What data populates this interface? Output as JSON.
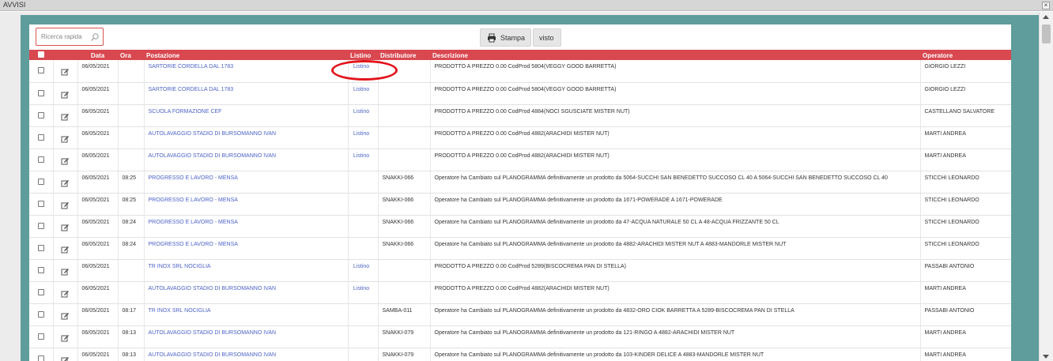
{
  "window": {
    "title": "AVVISI",
    "close_label": "×"
  },
  "toolbar": {
    "search_placeholder": "Ricerca rapida",
    "stampa_label": "Stampa",
    "visto_label": "visto"
  },
  "table": {
    "headers": {
      "data": "Data",
      "ora": "Ora",
      "postazione": "Postazione",
      "listino": "Listino",
      "distributore": "Distributore",
      "descrizione": "Descrizione",
      "operatore": "Operatore"
    },
    "rows": [
      {
        "data": "06/05/2021",
        "ora": "",
        "postazione": "SARTORIE CORDELLA DAL 1783",
        "listino": "Listino",
        "distributore": "",
        "descrizione": "PRODOTTO A PREZZO 0.00 CodProd 5804(VEGGY GOOD BARRETTA)",
        "operatore": "GIORGIO LEZZI"
      },
      {
        "data": "06/05/2021",
        "ora": "",
        "postazione": "SARTORIE CORDELLA DAL 1783",
        "listino": "Listino",
        "distributore": "",
        "descrizione": "PRODOTTO A PREZZO 0.00 CodProd 5804(VEGGY GOOD BARRETTA)",
        "operatore": "GIORGIO LEZZI"
      },
      {
        "data": "06/05/2021",
        "ora": "",
        "postazione": "SCUOLA FORMAZIONE CEF",
        "listino": "Listino",
        "distributore": "",
        "descrizione": "PRODOTTO A PREZZO 0.00 CodProd 4884(NOCI SGUSCIATE MISTER NUT)",
        "operatore": "CASTELLANO SALVATORE"
      },
      {
        "data": "06/05/2021",
        "ora": "",
        "postazione": "AUTOLAVAGGIO STADIO DI BURSOMANNO IVAN",
        "listino": "Listino",
        "distributore": "",
        "descrizione": "PRODOTTO A PREZZO 0.00 CodProd 4882(ARACHIDI MISTER NUT)",
        "operatore": "MARTI ANDREA"
      },
      {
        "data": "06/05/2021",
        "ora": "",
        "postazione": "AUTOLAVAGGIO STADIO DI BURSOMANNO IVAN",
        "listino": "Listino",
        "distributore": "",
        "descrizione": "PRODOTTO A PREZZO 0.00 CodProd 4882(ARACHIDI MISTER NUT)",
        "operatore": "MARTI ANDREA"
      },
      {
        "data": "06/05/2021",
        "ora": "08:25",
        "postazione": "PROGRESSO E LAVORO - MENSA",
        "listino": "",
        "distributore": "SNAKKI-066",
        "descrizione": "Operatore ha Cambiato sul PLANOGRAMMA definitivamente un prodotto da 5064-SUCCHI SAN BENEDETTO SUCCOSO CL 40 A 5064-SUCCHI SAN BENEDETTO SUCCOSO CL 40",
        "operatore": "STICCHI LEONARDO"
      },
      {
        "data": "06/05/2021",
        "ora": "08:25",
        "postazione": "PROGRESSO E LAVORO - MENSA",
        "listino": "",
        "distributore": "SNAKKI-066",
        "descrizione": "Operatore ha Cambiato sul PLANOGRAMMA definitivamente un prodotto da 1671-POWERADE A 1671-POWERADE",
        "operatore": "STICCHI LEONARDO"
      },
      {
        "data": "06/05/2021",
        "ora": "08:24",
        "postazione": "PROGRESSO E LAVORO - MENSA",
        "listino": "",
        "distributore": "SNAKKI-066",
        "descrizione": "Operatore ha Cambiato sul PLANOGRAMMA definitivamente un prodotto da 47-ACQUA NATURALE 50 CL A 48-ACQUA FRIZZANTE 50 CL",
        "operatore": "STICCHI LEONARDO"
      },
      {
        "data": "06/05/2021",
        "ora": "08:24",
        "postazione": "PROGRESSO E LAVORO - MENSA",
        "listino": "",
        "distributore": "SNAKKI-066",
        "descrizione": "Operatore ha Cambiato sul PLANOGRAMMA definitivamente un prodotto da 4882-ARACHIDI MISTER NUT A 4883-MANDORLE MISTER NUT",
        "operatore": "STICCHI LEONARDO"
      },
      {
        "data": "06/05/2021",
        "ora": "",
        "postazione": "TR INOX SRL NOCIGLIA",
        "listino": "Listino",
        "distributore": "",
        "descrizione": "PRODOTTO A PREZZO 0.00 CodProd 5289(BISCOCREMA PAN DI STELLA)",
        "operatore": "PASSABI ANTONIO"
      },
      {
        "data": "06/05/2021",
        "ora": "",
        "postazione": "AUTOLAVAGGIO STADIO DI BURSOMANNO IVAN",
        "listino": "Listino",
        "distributore": "",
        "descrizione": "PRODOTTO A PREZZO 0.00 CodProd 4882(ARACHIDI MISTER NUT)",
        "operatore": "MARTI ANDREA"
      },
      {
        "data": "06/05/2021",
        "ora": "08:17",
        "postazione": "TR INOX SRL NOCIGLIA",
        "listino": "",
        "distributore": "SAMBA-011",
        "descrizione": "Operatore ha Cambiato sul PLANOGRAMMA definitivamente un prodotto da 4832-ORO CIOK BARRETTA A 5289-BISCOCREMA PAN DI STELLA",
        "operatore": "PASSABI ANTONIO"
      },
      {
        "data": "06/05/2021",
        "ora": "08:13",
        "postazione": "AUTOLAVAGGIO STADIO DI BURSOMANNO IVAN",
        "listino": "",
        "distributore": "SNAKKI-079",
        "descrizione": "Operatore ha Cambiato sul PLANOGRAMMA definitivamente un prodotto da 121-RINGO A 4882-ARACHIDI MISTER NUT",
        "operatore": "MARTI ANDREA"
      },
      {
        "data": "06/05/2021",
        "ora": "08:13",
        "postazione": "AUTOLAVAGGIO STADIO DI BURSOMANNO IVAN",
        "listino": "",
        "distributore": "SNAKKI-079",
        "descrizione": "Operatore ha Cambiato sul PLANOGRAMMA definitivamente un prodotto da 103-KINDER DELICE A 4883-MANDORLE MISTER NUT",
        "operatore": "MARTI ANDREA"
      }
    ]
  },
  "colors": {
    "header_bg": "#d9474f",
    "link": "#4d63c8",
    "teal_bg": "#5f9d9c",
    "annotation_circle": "#e2141c"
  }
}
